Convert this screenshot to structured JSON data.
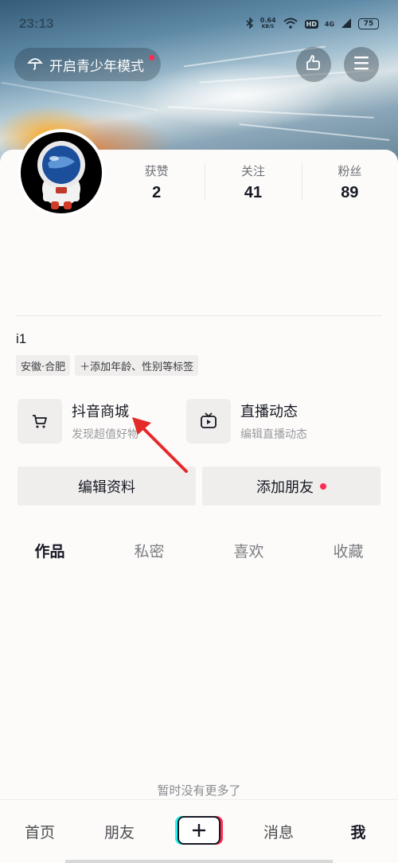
{
  "status_bar": {
    "time": "23:13",
    "net_speed_value": "0.64",
    "net_speed_unit": "KB/S",
    "hd_label": "HD",
    "signal_label": "4G",
    "battery": "75"
  },
  "header": {
    "youth_mode_label": "开启青少年模式"
  },
  "stats": [
    {
      "label": "获赞",
      "value": "2"
    },
    {
      "label": "关注",
      "value": "41"
    },
    {
      "label": "粉丝",
      "value": "89"
    }
  ],
  "profile": {
    "nickname": "i1",
    "location_tag": "安徽·合肥",
    "add_tag_label": "＋添加年龄、性别等标签"
  },
  "features": {
    "shop": {
      "title": "抖音商城",
      "subtitle": "发现超值好物"
    },
    "live": {
      "title": "直播动态",
      "subtitle": "编辑直播动态"
    }
  },
  "actions": {
    "edit_profile": "编辑资料",
    "add_friends": "添加朋友"
  },
  "tabs": [
    "作品",
    "私密",
    "喜欢",
    "收藏"
  ],
  "no_more_text": "暂时没有更多了",
  "bottom_nav": {
    "home": "首页",
    "friends": "朋友",
    "messages": "消息",
    "me": "我"
  },
  "colors": {
    "accent_red": "#fe2c55",
    "accent_cyan": "#25f4ee"
  }
}
